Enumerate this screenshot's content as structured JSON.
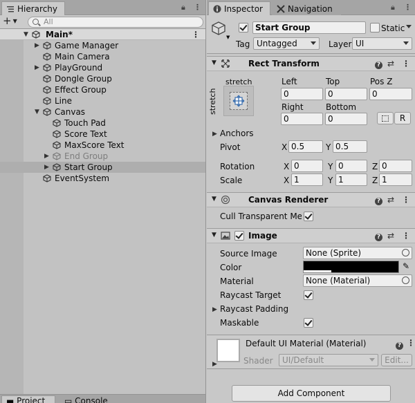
{
  "hierarchy": {
    "tab_label": "Hierarchy",
    "search_placeholder": "All",
    "scene": "Main*",
    "items": [
      {
        "label": "Game Manager",
        "indent": 1,
        "expandable": true,
        "disabled": false,
        "selected": false
      },
      {
        "label": "Main Camera",
        "indent": 1,
        "expandable": false,
        "disabled": false,
        "selected": false
      },
      {
        "label": "PlayGround",
        "indent": 1,
        "expandable": true,
        "disabled": false,
        "selected": false
      },
      {
        "label": "Dongle Group",
        "indent": 1,
        "expandable": false,
        "disabled": false,
        "selected": false
      },
      {
        "label": "Effect Group",
        "indent": 1,
        "expandable": false,
        "disabled": false,
        "selected": false
      },
      {
        "label": "Line",
        "indent": 1,
        "expandable": false,
        "disabled": false,
        "selected": false
      },
      {
        "label": "Canvas",
        "indent": 1,
        "expandable": true,
        "expanded": true,
        "disabled": false,
        "selected": false
      },
      {
        "label": "Touch Pad",
        "indent": 2,
        "expandable": false,
        "disabled": false,
        "selected": false
      },
      {
        "label": "Score Text",
        "indent": 2,
        "expandable": false,
        "disabled": false,
        "selected": false
      },
      {
        "label": "MaxScore Text",
        "indent": 2,
        "expandable": false,
        "disabled": false,
        "selected": false
      },
      {
        "label": "End Group",
        "indent": 2,
        "expandable": true,
        "disabled": true,
        "selected": false
      },
      {
        "label": "Start Group",
        "indent": 2,
        "expandable": true,
        "disabled": false,
        "selected": true
      },
      {
        "label": "EventSystem",
        "indent": 1,
        "expandable": false,
        "disabled": false,
        "selected": false
      }
    ],
    "bottom_tabs": [
      "Project",
      "Console"
    ]
  },
  "inspector": {
    "tabs": {
      "inspector": "Inspector",
      "navigation": "Navigation"
    },
    "object_name": "Start Group",
    "active": true,
    "static_label": "Static",
    "tag_label": "Tag",
    "tag_value": "Untagged",
    "layer_label": "Layer",
    "layer_value": "UI",
    "rect_transform": {
      "title": "Rect Transform",
      "anchor_top": "stretch",
      "anchor_side": "stretch",
      "left_label": "Left",
      "left": "0",
      "top_label": "Top",
      "top": "0",
      "posz_label": "Pos Z",
      "posz": "0",
      "right_label": "Right",
      "right": "0",
      "bottom_label": "Bottom",
      "bottom": "0",
      "r_button": "R",
      "anchors_label": "Anchors",
      "pivot_label": "Pivot",
      "pivot_x": "0.5",
      "pivot_y": "0.5",
      "rotation_label": "Rotation",
      "rot_x": "0",
      "rot_y": "0",
      "rot_z": "0",
      "scale_label": "Scale",
      "scale_x": "1",
      "scale_y": "1",
      "scale_z": "1",
      "x": "X",
      "y": "Y",
      "z": "Z"
    },
    "canvas_renderer": {
      "title": "Canvas Renderer",
      "cull_label": "Cull Transparent Mes",
      "cull": true
    },
    "image": {
      "title": "Image",
      "enabled": true,
      "source_label": "Source Image",
      "source_value": "None (Sprite)",
      "color_label": "Color",
      "color_value": "#000000",
      "material_label": "Material",
      "material_value": "None (Material)",
      "raycast_target_label": "Raycast Target",
      "raycast_target": true,
      "raycast_padding_label": "Raycast Padding",
      "maskable_label": "Maskable",
      "maskable": true
    },
    "material": {
      "title": "Default UI Material (Material)",
      "shader_label": "Shader",
      "shader_value": "UI/Default",
      "edit_button": "Edit..."
    },
    "add_component": "Add Component"
  }
}
